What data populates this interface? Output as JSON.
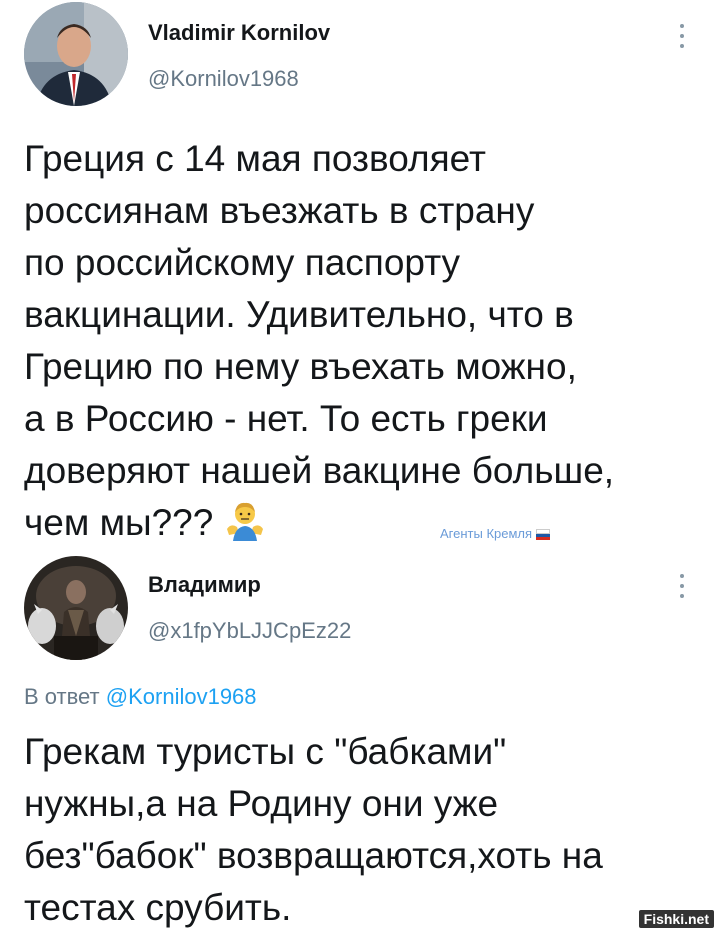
{
  "tweet1": {
    "author_name": "Vladimir Kornilov",
    "author_handle": "@Kornilov1968",
    "lines": [
      "Греция с 14 мая позволяет",
      "россиянам въезжать в страну",
      "по российскому паспорту",
      "вакцинации. Удивительно, что в",
      "Грецию по нему въехать можно,",
      "а в Россию - нет. То есть греки",
      "доверяют нашей вакцине больше,",
      "чем мы???"
    ],
    "emoji": "man-shrugging-icon"
  },
  "watermark": {
    "kremlin_text": "Агенты Кремля",
    "fishki_text": "Fishki.net"
  },
  "tweet2": {
    "author_name": "Владимир",
    "author_handle": "@x1fpYbLJJCpEz22",
    "reply_prefix": "В ответ",
    "reply_handle": "@Kornilov1968",
    "lines": [
      "Грекам туристы с \"бабками\"",
      "нужны,а на Родину они уже",
      "без\"бабок\" возвращаются,хоть на",
      "тестах срубить."
    ]
  },
  "colors": {
    "text": "#14171a",
    "secondary": "#657786",
    "link": "#1da1f2"
  }
}
